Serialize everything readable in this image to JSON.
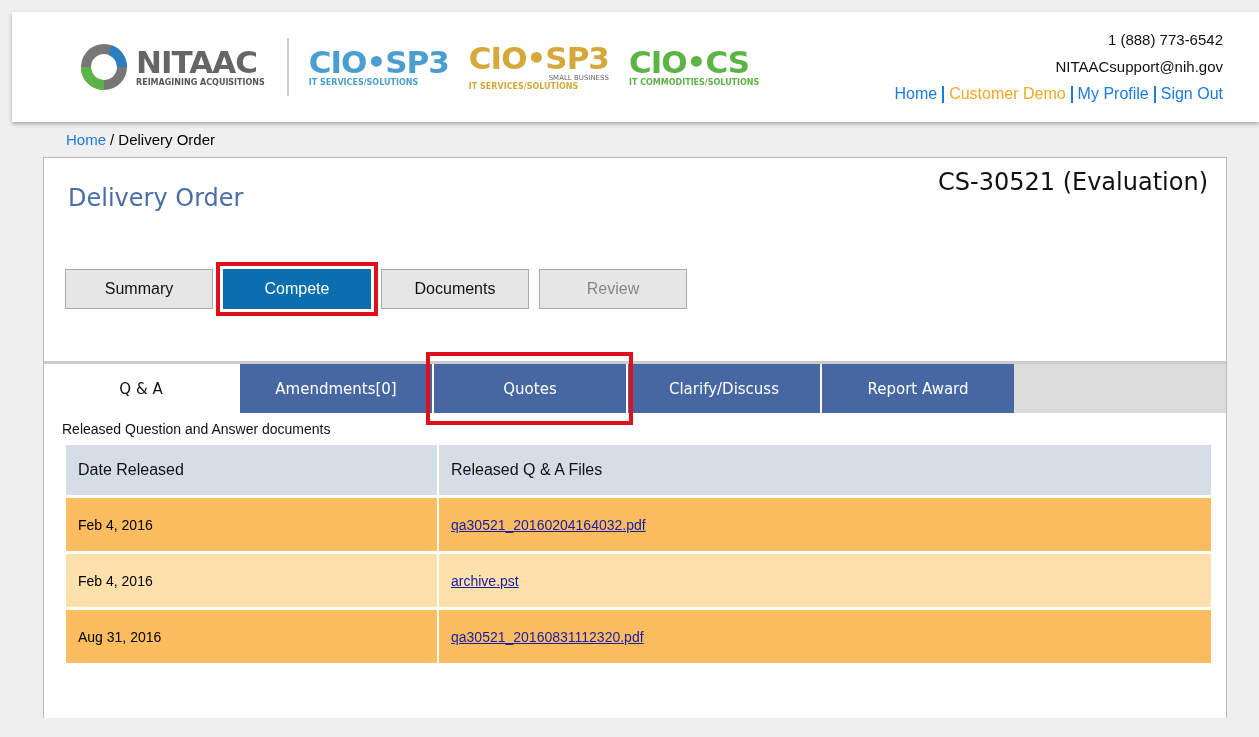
{
  "header": {
    "logo": {
      "name": "NITAAC",
      "tagline": "REIMAGINING ACQUISITIONS"
    },
    "programs": [
      {
        "name": "CIO•SP3",
        "sub": "IT SERVICES/SOLUTIONS",
        "color": "#4a9fd0"
      },
      {
        "name": "CIO•SP3",
        "sub": "IT SERVICES/SOLUTIONS",
        "note": "SMALL BUSINESS",
        "color": "#d4a93a"
      },
      {
        "name": "CIO•CS",
        "sub": "IT COMMODITIES/SOLUTIONS",
        "color": "#5cb346"
      }
    ],
    "phone": "1 (888) 773-6542",
    "email": "NITAACsupport@nih.gov",
    "nav": [
      {
        "label": "Home",
        "selected": false
      },
      {
        "label": "Customer Demo",
        "selected": true
      },
      {
        "label": "My Profile",
        "selected": false
      },
      {
        "label": "Sign Out",
        "selected": false
      }
    ]
  },
  "breadcrumb": {
    "link": "Home",
    "current": "/ Delivery Order"
  },
  "page": {
    "title": "Delivery Order",
    "order_id": "CS-30521 (Evaluation)"
  },
  "buttons": [
    {
      "label": "Summary",
      "selected": false,
      "disabled": false,
      "highlighted": false
    },
    {
      "label": "Compete",
      "selected": true,
      "disabled": false,
      "highlighted": true
    },
    {
      "label": "Documents",
      "selected": false,
      "disabled": false,
      "highlighted": false
    },
    {
      "label": "Review",
      "selected": false,
      "disabled": true,
      "highlighted": false
    }
  ],
  "tabs": [
    {
      "label": "Q & A",
      "selected": true,
      "highlighted": false
    },
    {
      "label": "Amendments[0]",
      "selected": false,
      "highlighted": false
    },
    {
      "label": "Quotes",
      "selected": false,
      "highlighted": true
    },
    {
      "label": "Clarify/Discuss",
      "selected": false,
      "highlighted": false
    },
    {
      "label": "Report Award",
      "selected": false,
      "highlighted": false
    }
  ],
  "section_caption": "Released Question and Answer documents",
  "table": {
    "columns": [
      "Date Released",
      "Released Q & A Files"
    ],
    "rows": [
      {
        "date": "Feb 4, 2016",
        "file": "qa30521_20160204164032.pdf"
      },
      {
        "date": "Feb 4, 2016",
        "file": "archive.pst"
      },
      {
        "date": "Aug 31, 2016",
        "file": "qa30521_20160831112320.pdf"
      }
    ]
  }
}
